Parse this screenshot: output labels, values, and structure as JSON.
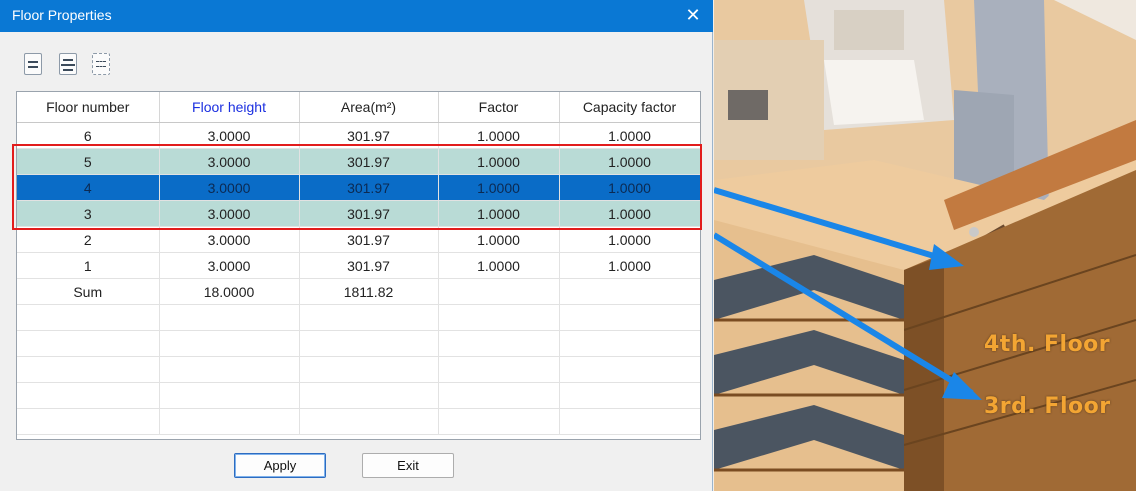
{
  "dialog": {
    "title": "Floor Properties",
    "close_glyph": "✕",
    "toolbar": [
      {
        "icon": "insert-floor-icon"
      },
      {
        "icon": "split-floor-icon"
      },
      {
        "icon": "select-floor-icon"
      }
    ],
    "columns": [
      "Floor number",
      "Floor height",
      "Area(m²)",
      "Factor",
      "Capacity factor"
    ],
    "rows": [
      {
        "floor": "6",
        "height": "3.0000",
        "area": "301.97",
        "factor": "1.0000",
        "capacity": "1.0000",
        "state": "normal"
      },
      {
        "floor": "5",
        "height": "3.0000",
        "area": "301.97",
        "factor": "1.0000",
        "capacity": "1.0000",
        "state": "highlight"
      },
      {
        "floor": "4",
        "height": "3.0000",
        "area": "301.97",
        "factor": "1.0000",
        "capacity": "1.0000",
        "state": "selected"
      },
      {
        "floor": "3",
        "height": "3.0000",
        "area": "301.97",
        "factor": "1.0000",
        "capacity": "1.0000",
        "state": "highlight"
      },
      {
        "floor": "2",
        "height": "3.0000",
        "area": "301.97",
        "factor": "1.0000",
        "capacity": "1.0000",
        "state": "normal"
      },
      {
        "floor": "1",
        "height": "3.0000",
        "area": "301.97",
        "factor": "1.0000",
        "capacity": "1.0000",
        "state": "normal"
      }
    ],
    "sum_row": {
      "floor": "Sum",
      "height": "18.0000",
      "area": "1811.82",
      "factor": "",
      "capacity": ""
    },
    "empty_rows": 5,
    "buttons": {
      "apply": "Apply",
      "exit": "Exit"
    }
  },
  "render": {
    "label_4th": "4th. Floor",
    "label_3rd": "3rd. Floor"
  },
  "colors": {
    "titlebar": "#0a78d4",
    "highlight_row": "#b9dbd6",
    "selected_row": "#0a6cc7",
    "callout_box": "#e21c1c",
    "arrow": "#1a86e8",
    "floor_label": "#f3a533"
  }
}
